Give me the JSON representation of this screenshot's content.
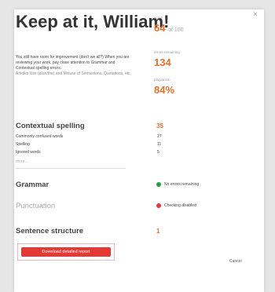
{
  "dialog": {
    "title": "Keep at it, William!",
    "close_label": "×",
    "intro_text": "You still have room for improvement (don't we all?) When you are reviewing your work, pay close attention to Grammar and Contextual spelling errors.",
    "intro_categories": "Articles Use (a/an/the) and Misuse of Semicolons, Quotations, etc.",
    "score_label": "score",
    "score_value": "64",
    "score_of": "of 100",
    "errors_label": "errors remaining",
    "errors_value": "134",
    "plagiarism_label": "plagiarism",
    "plagiarism_value": "84%",
    "categories": {
      "contextual": {
        "title": "Contextual spelling",
        "count": "35",
        "subs": [
          {
            "label": "Commonly confused words",
            "count": "27"
          },
          {
            "label": "Spelling",
            "count": "11"
          },
          {
            "label": "Ignored words",
            "count": "5"
          }
        ],
        "more": "more..."
      },
      "grammar": {
        "title": "Grammar",
        "status": "No errors remaining"
      },
      "punctuation": {
        "title": "Punctuation",
        "status": "Checking disabled"
      },
      "sentence": {
        "title": "Sentence structure",
        "count": "1"
      }
    },
    "download_label": "Download detailed report",
    "cancel_label": "Cancel"
  },
  "colors": {
    "accent": "#e8702a",
    "green": "#2e9b3e",
    "red": "#e53935"
  }
}
